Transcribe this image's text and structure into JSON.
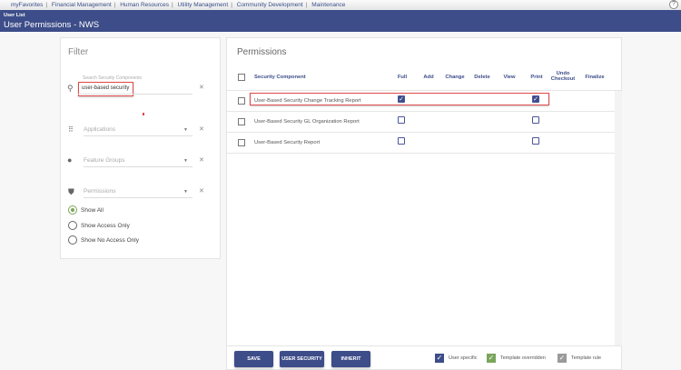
{
  "topnav": {
    "items": [
      "myFavorites",
      "Financial Management",
      "Human Resources",
      "Utility Management",
      "Community Development",
      "Maintenance"
    ]
  },
  "header": {
    "breadcrumb": "User List",
    "title": "User Permissions - NWS"
  },
  "filter": {
    "title": "Filter",
    "search_label": "Search Security Components",
    "search_value": "user-based security",
    "applications": "Applications",
    "feature_groups": "Feature Groups",
    "permissions": "Permissions",
    "radios": [
      {
        "label": "Show All",
        "selected": true
      },
      {
        "label": "Show Access Only",
        "selected": false
      },
      {
        "label": "Show No Access Only",
        "selected": false
      }
    ]
  },
  "permissions": {
    "title": "Permissions",
    "columns": [
      "Security Component",
      "Full",
      "Add",
      "Change",
      "Delete",
      "View",
      "Print",
      "Undo Checkout",
      "Finalize"
    ],
    "rows": [
      {
        "name": "User-Based Security Change Tracking Report",
        "full": true,
        "print": true
      },
      {
        "name": "User-Based Security GL Organization Report",
        "full": false,
        "print": false
      },
      {
        "name": "User-Based Security Report",
        "full": false,
        "print": false
      }
    ]
  },
  "buttons": {
    "save": "SAVE",
    "user_security": "USER SECURITY",
    "inherit": "INHERIT"
  },
  "legend": [
    {
      "label": "User specific",
      "color": "#3d4d89"
    },
    {
      "label": "Template overridden",
      "color": "#7aa55b"
    },
    {
      "label": "Template rule",
      "color": "#9a9a9a"
    }
  ]
}
